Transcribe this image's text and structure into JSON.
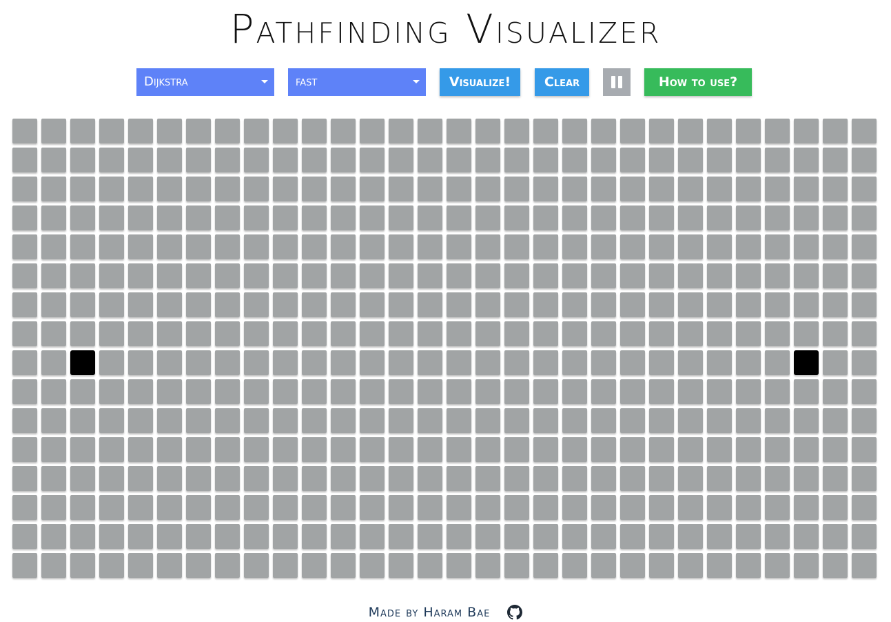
{
  "page": {
    "title": "Pathfinding Visualizer"
  },
  "toolbar": {
    "algorithm_select": {
      "value": "Dijkstra"
    },
    "speed_select": {
      "value": "fast"
    },
    "visualize_label": "Visualize!",
    "clear_label": "Clear",
    "pause_icon": "pause-icon",
    "help_label": "How to use?"
  },
  "grid": {
    "rows": 16,
    "cols": 30,
    "start_node": {
      "row": 8,
      "col": 2
    },
    "end_node": {
      "row": 8,
      "col": 27
    }
  },
  "footer": {
    "credit": "Made by Haram Bae",
    "icon": "github-icon"
  },
  "colors": {
    "select_bg": "#5e82f8",
    "primary_btn": "#359ae8",
    "help_btn": "#37bb5b",
    "disabled_btn": "#a7abb0",
    "cell": "#a1a4a5",
    "endpoint_cell": "#000000"
  }
}
